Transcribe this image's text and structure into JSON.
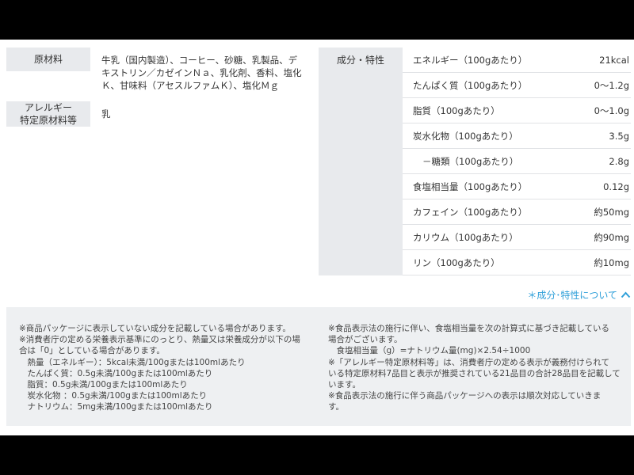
{
  "ingredients": {
    "label": "原材料",
    "lines": [
      "牛乳（国内製造）、コーヒー、砂糖、乳製品、デ",
      "キストリン／カゼインＮａ、乳化剤、香料、塩化",
      "Ｋ、甘味料（アセスルファムＫ）、塩化Ｍｇ"
    ]
  },
  "allergen": {
    "label_lines": [
      "アレルギー",
      "特定原材料等"
    ],
    "value": "乳"
  },
  "nutrition": {
    "label": "成分・特性",
    "rows": [
      {
        "name": "エネルギー（100gあたり）",
        "value": "21kcal"
      },
      {
        "name": "たんぱく質（100gあたり）",
        "value": "0～1.2g"
      },
      {
        "name": "脂質（100gあたり）",
        "value": "0～1.0g"
      },
      {
        "name": "炭水化物（100gあたり）",
        "value": "3.5g"
      },
      {
        "name": "－糖類（100gあたり）",
        "value": "2.8g"
      },
      {
        "name": "食塩相当量（100gあたり）",
        "value": "0.12g"
      },
      {
        "name": "カフェイン（100gあたり）",
        "value": "約50mg"
      },
      {
        "name": "カリウム（100gあたり）",
        "value": "約90mg"
      },
      {
        "name": "リン（100gあたり）",
        "value": "約10mg"
      }
    ]
  },
  "about_link": "＊成分･特性について",
  "notes": {
    "left": [
      "※商品パッケージに表示していない成分を記載している場合があります。",
      "※消費者庁の定める栄養表示基準にのっとり、熱量又は栄養成分が以下の場",
      "合は「0」としている場合があります。",
      "　熱量（エネルギー）：5kcal未満/100gまたは100mlあたり",
      "　たんぱく質：0.5g未満/100gまたは100mlあたり",
      "　脂質：0.5g未満/100gまたは100mlあたり",
      "　炭水化物 ：0.5g未満/100gまたは100mlあたり",
      "　ナトリウム：5mg未満/100gまたは100mlあたり"
    ],
    "right": [
      "※食品表示法の施行に伴い、食塩相当量を次の計算式に基づき記載している",
      "場合がございます。",
      "　食塩相当量（g）=ナトリウム量(mg)×2.54÷1000",
      "※「アレルギー特定原材料等」は、消費者庁の定める表示が義務付けられて",
      "いる特定原材料7品目と表示が推奨されている21品目の合計28品目を記載して",
      "います。",
      "※食品表示法の施行に伴う商品パッケージへの表示は順次対応していきま",
      "す。"
    ]
  },
  "colors": {
    "accent": "#2e9fd9",
    "label_bg": "#e8eaed",
    "notes_bg": "#eef0f2"
  }
}
